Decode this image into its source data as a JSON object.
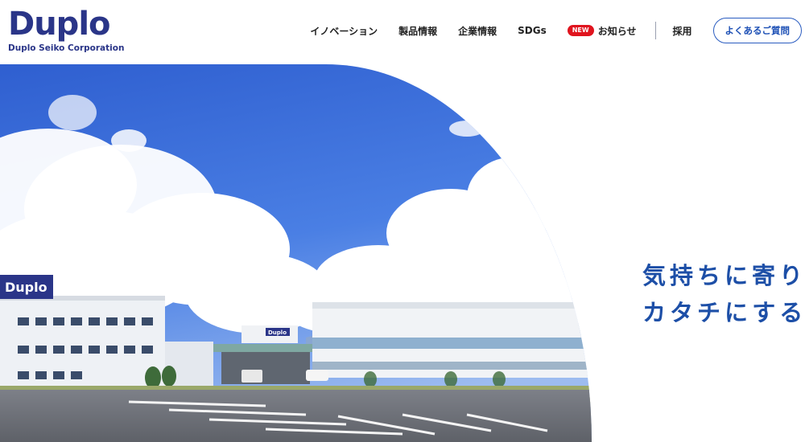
{
  "brand": {
    "name": "Duplo",
    "subtitle": "Duplo Seiko Corporation",
    "color": "#2a3588"
  },
  "nav": {
    "items": [
      {
        "label": "イノベーション"
      },
      {
        "label": "製品情報"
      },
      {
        "label": "企業情報"
      },
      {
        "label": "SDGs"
      },
      {
        "label": "お知らせ",
        "badge": "NEW"
      },
      {
        "label": "採用"
      }
    ],
    "faq_label": "よくあるご質問"
  },
  "hero": {
    "building_sign": "Duplo",
    "building_sign_small": "Duplo",
    "icon": "factory-photo"
  },
  "tagline": {
    "line1": "気持ちに寄り",
    "line2": "カタチにする"
  },
  "colors": {
    "accent": "#1d4fa7",
    "badge": "#e0141e",
    "sky": "#3f6fdc"
  }
}
